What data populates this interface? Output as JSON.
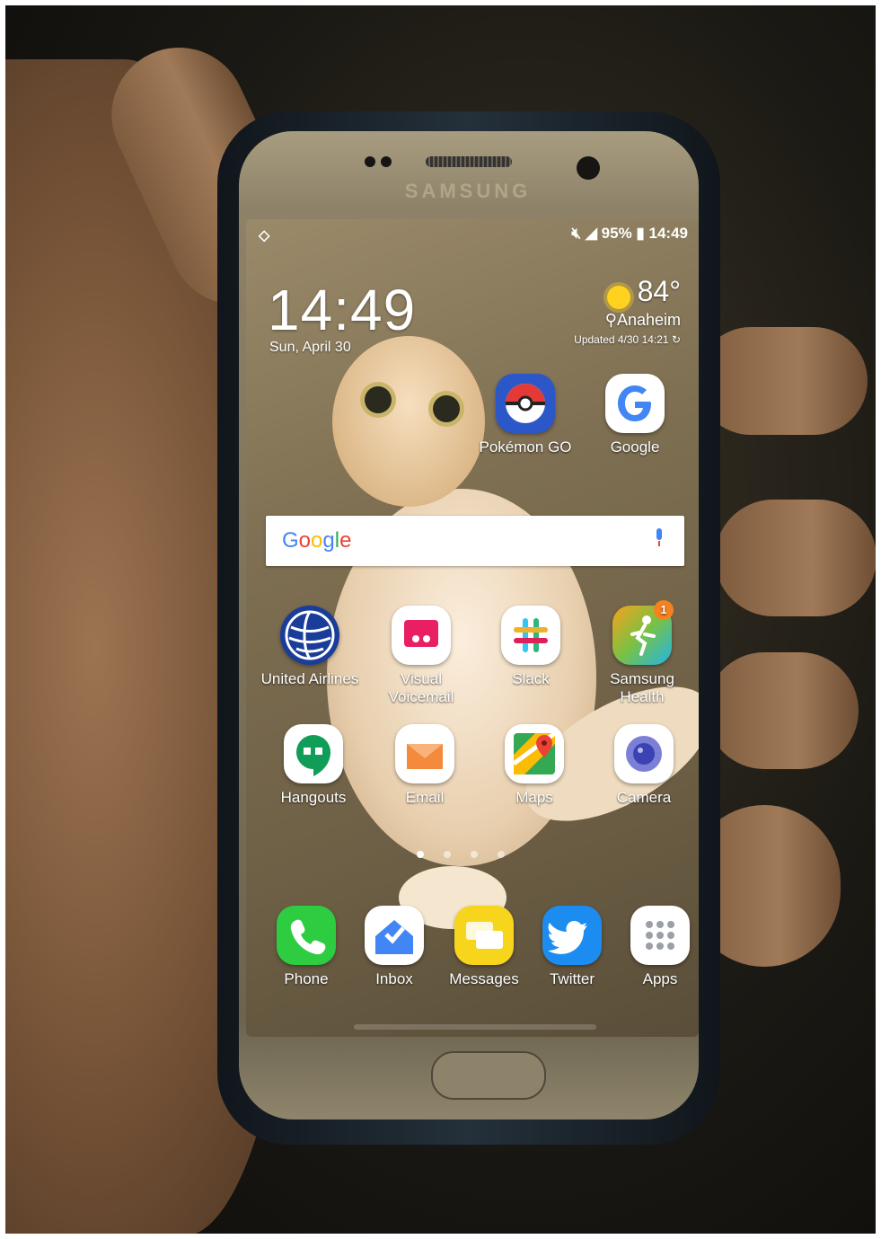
{
  "device": {
    "brand": "SAMSUNG"
  },
  "status_bar": {
    "battery": "95%",
    "time": "14:49"
  },
  "lock_clock": {
    "time": "14:49",
    "date": "Sun, April 30"
  },
  "weather": {
    "temperature": "84°",
    "location": "Anaheim",
    "updated": "Updated 4/30 14:21"
  },
  "search": {
    "logo_text": "Google",
    "colors": [
      "#4285F4",
      "#EA4335",
      "#FBBC05",
      "#4285F4",
      "#34A853",
      "#EA4335"
    ]
  },
  "home_apps": [
    {
      "label": "Pokémon GO",
      "icon": "pokeball-icon"
    },
    {
      "label": "Google",
      "icon": "google-g-icon"
    },
    {
      "label": "United Airlines",
      "icon": "united-globe-icon"
    },
    {
      "label": "Visual Voicemail",
      "icon": "voicemail-icon"
    },
    {
      "label": "Slack",
      "icon": "slack-icon"
    },
    {
      "label": "Samsung Health",
      "icon": "health-runner-icon",
      "badge": "1"
    },
    {
      "label": "Hangouts",
      "icon": "hangouts-icon"
    },
    {
      "label": "Email",
      "icon": "email-envelope-icon"
    },
    {
      "label": "Maps",
      "icon": "maps-pin-icon"
    },
    {
      "label": "Camera",
      "icon": "camera-lens-icon"
    }
  ],
  "dock_apps": [
    {
      "label": "Phone",
      "icon": "phone-handset-icon"
    },
    {
      "label": "Inbox",
      "icon": "inbox-icon"
    },
    {
      "label": "Messages",
      "icon": "messages-icon"
    },
    {
      "label": "Twitter",
      "icon": "twitter-bird-icon"
    },
    {
      "label": "Apps",
      "icon": "app-grid-icon"
    }
  ],
  "colors": {
    "phone_green": "#2ecc40",
    "messages_yellow": "#f7d51d",
    "twitter_blue": "#1d8cf0",
    "badge_orange": "#f5811f"
  }
}
